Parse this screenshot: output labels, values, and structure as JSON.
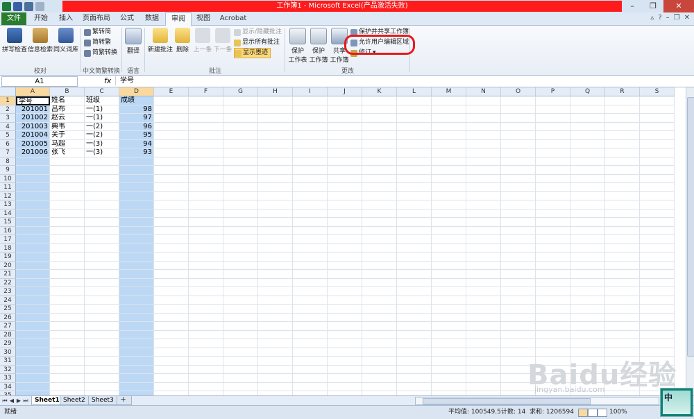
{
  "window": {
    "title": "工作簿1 - Microsoft Excel(产品激活失败)",
    "controls": [
      "–",
      "❐",
      "✕"
    ]
  },
  "tabs": [
    {
      "label": "文件",
      "kind": "file"
    },
    {
      "label": "开始"
    },
    {
      "label": "插入"
    },
    {
      "label": "页面布局"
    },
    {
      "label": "公式"
    },
    {
      "label": "数据"
    },
    {
      "label": "审阅",
      "kind": "active"
    },
    {
      "label": "视图"
    },
    {
      "label": "Acrobat"
    }
  ],
  "ribbon": {
    "proofing": {
      "group": "校对",
      "buttons": [
        "拼写检查",
        "信息检索",
        "同义词库"
      ]
    },
    "chinese": {
      "group": "中文简繁转换",
      "buttons": [
        "繁转简",
        "简转繁",
        "简繁转换"
      ]
    },
    "language": {
      "group": "语言",
      "button": "翻译"
    },
    "comments": {
      "group": "批注",
      "new": "新建批注",
      "delete": "删除",
      "prev": "上一条",
      "next": "下一条",
      "show_hide": "显示/隐藏批注",
      "show_all": "显示所有批注",
      "show_ink": "显示墨迹"
    },
    "changes": {
      "group": "更改",
      "protect_sheet": [
        "保护",
        "工作表"
      ],
      "protect_book": [
        "保护",
        "工作簿"
      ],
      "share_book": [
        "共享",
        "工作簿"
      ],
      "protect_share": "保护并共享工作簿",
      "allow_edit": "允许用户编辑区域",
      "track": "修订"
    }
  },
  "formula_bar": {
    "name_box": "A1",
    "fx": "fx",
    "content": "学号"
  },
  "columns": [
    "A",
    "B",
    "C",
    "D",
    "E",
    "F",
    "G",
    "H",
    "I",
    "J",
    "K",
    "L",
    "M",
    "N",
    "O",
    "P",
    "Q",
    "R",
    "S"
  ],
  "row_count": 35,
  "table": [
    [
      "学号",
      "姓名",
      "班级",
      "成绩"
    ],
    [
      "201001",
      "吕布",
      "一(1)",
      "98"
    ],
    [
      "201002",
      "赵云",
      "一(1)",
      "97"
    ],
    [
      "201003",
      "典韦",
      "一(2)",
      "96"
    ],
    [
      "201004",
      "关于",
      "一(2)",
      "95"
    ],
    [
      "201005",
      "马超",
      "一(3)",
      "94"
    ],
    [
      "201006",
      "张飞",
      "一(3)",
      "93"
    ]
  ],
  "sheets": [
    "Sheet1",
    "Sheet2",
    "Sheet3"
  ],
  "status": {
    "ready": "就绪",
    "average": "平均值: 100549.5",
    "count": "计数: 14",
    "sum": "求和: 1206594",
    "zoom": "100%"
  },
  "ime": "中",
  "watermark": {
    "text": "Baidu经验",
    "url": "jingyan.baidu.com"
  },
  "colors": {
    "title_red": "#ff1b1b",
    "file_tab": "#2a7d2e",
    "selected_col": "#bcd8f5",
    "highlight": "#e8191b"
  }
}
